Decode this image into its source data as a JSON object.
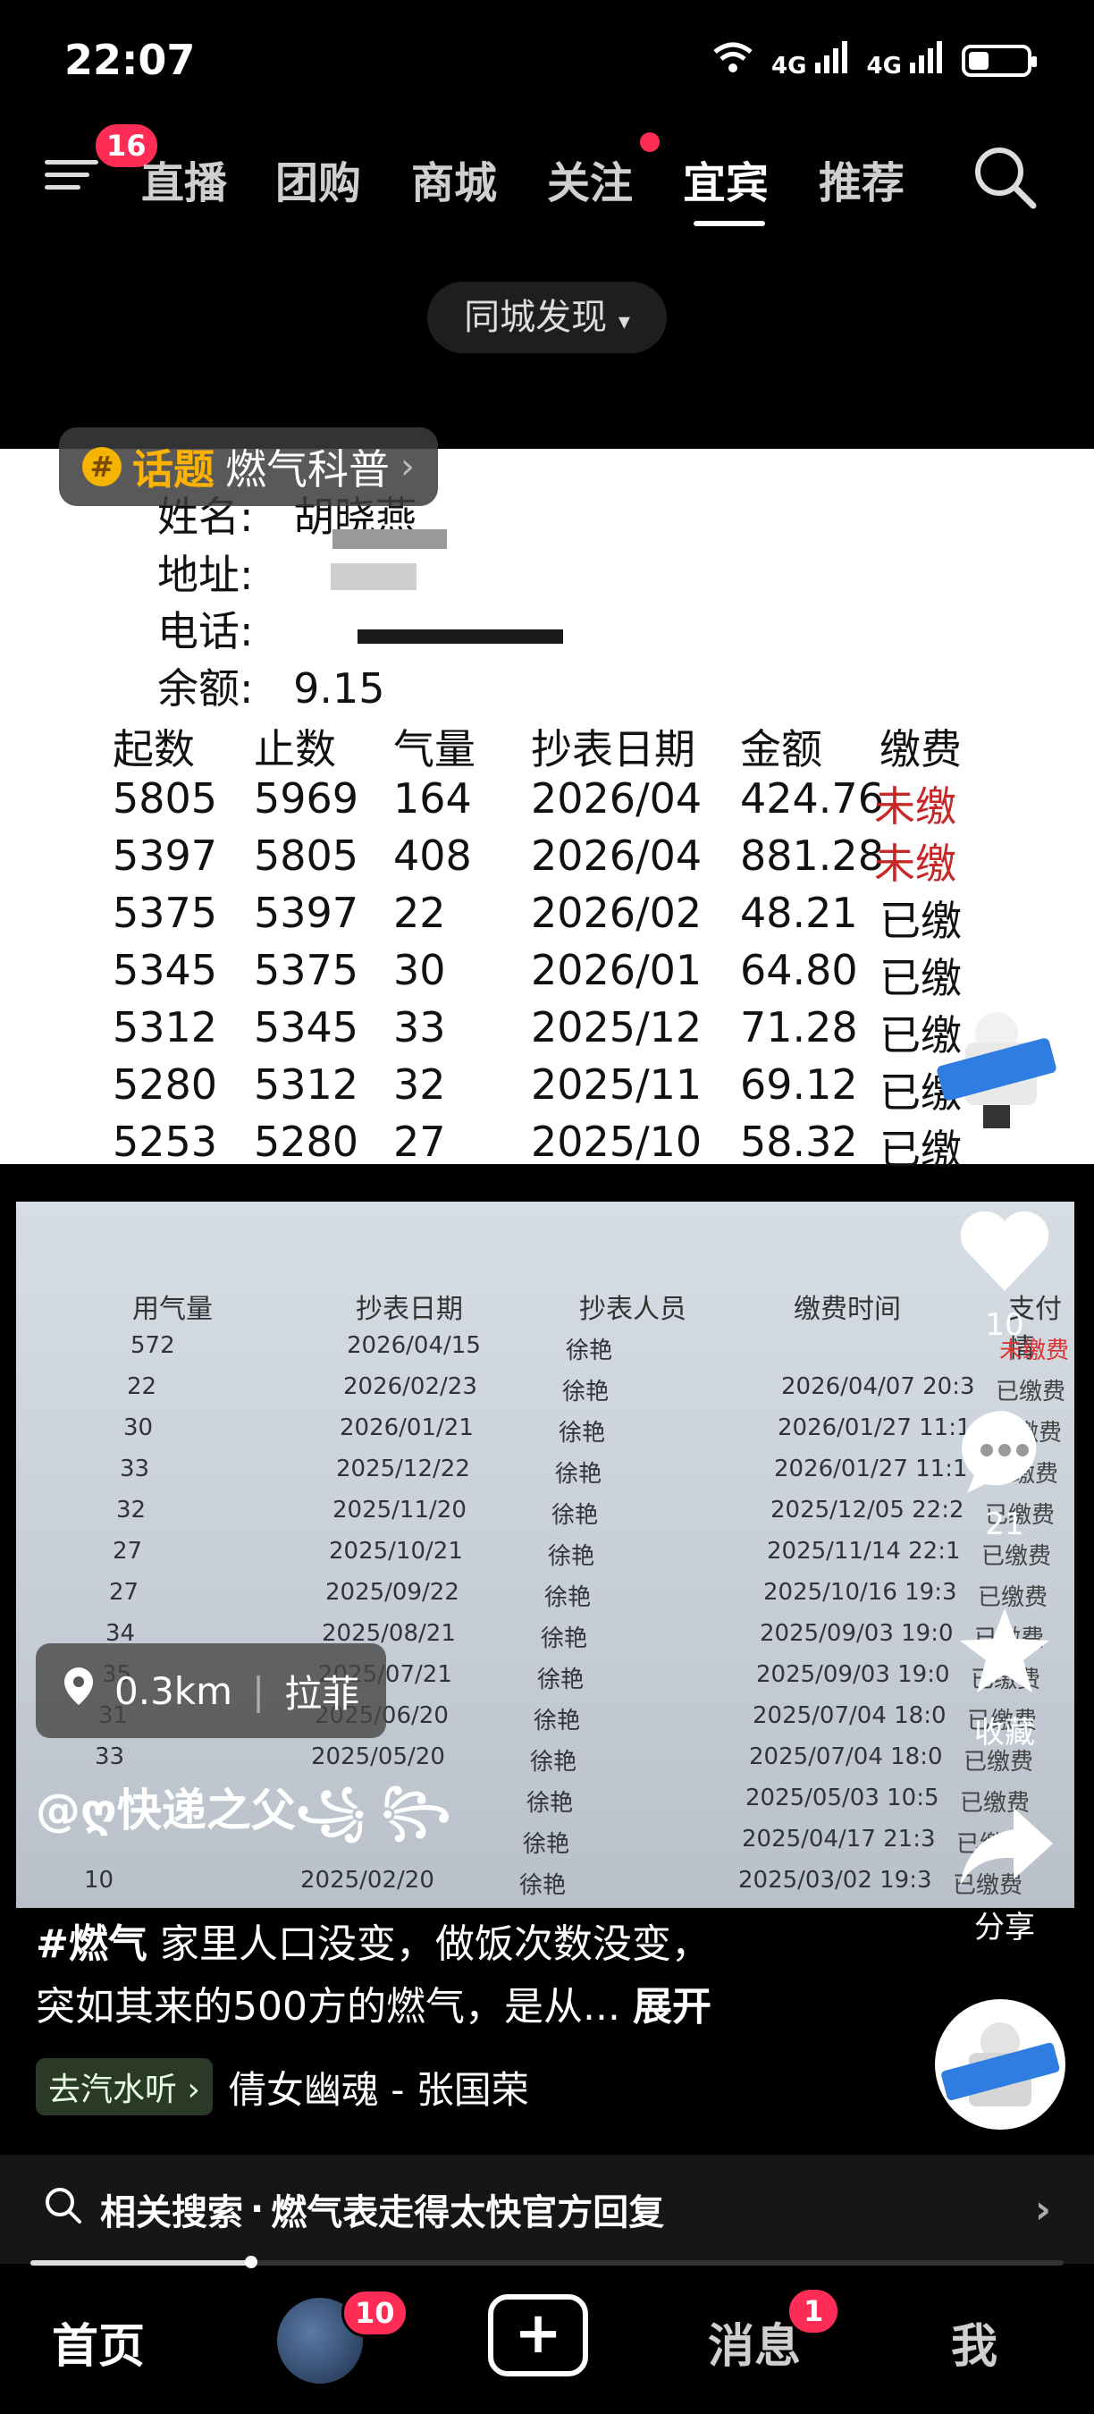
{
  "status": {
    "time": "22:07",
    "net1": "4G",
    "net2": "4G",
    "battery_level": 0.35
  },
  "topnav": {
    "menu_badge": "16",
    "tabs": [
      "直播",
      "团购",
      "商城",
      "关注",
      "宜宾",
      "推荐"
    ],
    "active": "宜宾",
    "city_pill": "同城发现"
  },
  "topic": {
    "label": "话题",
    "name": "燃气科普"
  },
  "sheet": {
    "name_label": "姓名:",
    "name_value": "胡晓燕",
    "address_label": "地址:",
    "phone_label": "电话:",
    "balance_label": "余额:",
    "balance_value": "9.15",
    "headers": [
      "起数",
      "止数",
      "气量",
      "抄表日期",
      "金额",
      "缴费"
    ],
    "rows": [
      [
        "5805",
        "5969",
        "164",
        "2026/04",
        "424.76",
        "未缴"
      ],
      [
        "5397",
        "5805",
        "408",
        "2026/04",
        "881.28",
        "未缴"
      ],
      [
        "5375",
        "5397",
        "22",
        "2026/02",
        "48.21",
        "已缴"
      ],
      [
        "5345",
        "5375",
        "30",
        "2026/01",
        "64.80",
        "已缴"
      ],
      [
        "5312",
        "5345",
        "33",
        "2025/12",
        "71.28",
        "已缴"
      ],
      [
        "5280",
        "5312",
        "32",
        "2025/11",
        "69.12",
        "已缴"
      ],
      [
        "5253",
        "5280",
        "27",
        "2025/10",
        "58.32",
        "已缴"
      ]
    ]
  },
  "photo": {
    "headers": [
      "用气量",
      "抄表日期",
      "抄表人员",
      "缴费时间",
      "支付情"
    ],
    "rows": [
      [
        "572",
        "2026/04/15",
        "徐艳",
        "",
        "未缴费"
      ],
      [
        "22",
        "2026/02/23",
        "徐艳",
        "2026/04/07 20:3",
        "已缴费"
      ],
      [
        "30",
        "2026/01/21",
        "徐艳",
        "2026/01/27 11:1",
        "已缴费"
      ],
      [
        "33",
        "2025/12/22",
        "徐艳",
        "2026/01/27 11:1",
        "已缴费"
      ],
      [
        "32",
        "2025/11/20",
        "徐艳",
        "2025/12/05 22:2",
        "已缴费"
      ],
      [
        "27",
        "2025/10/21",
        "徐艳",
        "2025/11/14 22:1",
        "已缴费"
      ],
      [
        "27",
        "2025/09/22",
        "徐艳",
        "2025/10/16 19:3",
        "已缴费"
      ],
      [
        "34",
        "2025/08/21",
        "徐艳",
        "2025/09/03 19:0",
        "已缴费"
      ],
      [
        "35",
        "2025/07/21",
        "徐艳",
        "2025/09/03 19:0",
        "已缴费"
      ],
      [
        "31",
        "2025/06/20",
        "徐艳",
        "2025/07/04 18:0",
        "已缴费"
      ],
      [
        "33",
        "2025/05/20",
        "徐艳",
        "2025/07/04 18:0",
        "已缴费"
      ],
      [
        "",
        "",
        "徐艳",
        "2025/05/03 10:5",
        "已缴费"
      ],
      [
        "",
        "",
        "徐艳",
        "2025/04/17 21:3",
        "已缴费"
      ],
      [
        "10",
        "2025/02/20",
        "徐艳",
        "2025/03/02 19:3",
        "已缴费"
      ]
    ]
  },
  "actions": {
    "likes": "10",
    "comments": "21",
    "collect": "收藏",
    "share": "分享"
  },
  "location": {
    "distance": "0.3km",
    "place": "拉菲"
  },
  "author": "@ღ快递之父꧁ ꧂",
  "caption": {
    "hashtag": "#燃气",
    "line1": " 家里人口没变，做饭次数没变，",
    "line2": "突如其来的500方的燃气，是从...",
    "expand": "展开"
  },
  "music": {
    "tag": "去汽水听",
    "song": "倩女幽魂 - 张国荣"
  },
  "related": {
    "prefix": "相关搜索",
    "query": "燃气表走得太快官方回复"
  },
  "tabbar": {
    "home": "首页",
    "friends_badge": "10",
    "messages": "消息",
    "messages_badge": "1",
    "me": "我"
  }
}
